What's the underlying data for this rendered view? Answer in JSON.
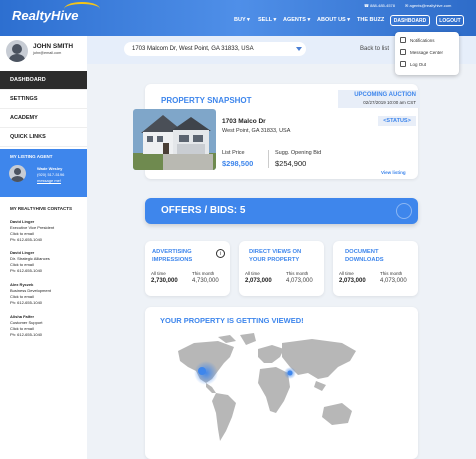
{
  "brand": {
    "logo_text": "RealtyHive"
  },
  "header": {
    "phone": "888-485-4578",
    "email": "agents@realtyhive.com",
    "nav": [
      {
        "label": "BUY"
      },
      {
        "label": "SELL"
      },
      {
        "label": "AGENTS"
      },
      {
        "label": "ABOUT US"
      },
      {
        "label": "THE BUZZ"
      }
    ],
    "dashboard_button": "DASHBOARD",
    "logout_button": "LOGOUT"
  },
  "user": {
    "name": "JOHN SMITH",
    "email": "john@email.com"
  },
  "sidebar": {
    "items": [
      {
        "label": "DASHBOARD",
        "active": true
      },
      {
        "label": "SETTINGS"
      },
      {
        "label": "ACADEMY"
      },
      {
        "label": "QUICK LINKS"
      }
    ],
    "agent": {
      "title": "MY LISTING AGENT",
      "name": "Wade Wesley",
      "phone": "(920) 517-5196",
      "message": "message me!"
    },
    "contacts_title": "MY REALTYHIVE CONTACTS",
    "contacts": [
      {
        "name": "David Linger",
        "role": "Executive Vice President",
        "email": "Click to email",
        "phone": "Ph: 612-655-1040"
      },
      {
        "name": "David Linger",
        "role": "Dir. Strategic Alliances",
        "email": "Click to email",
        "phone": "Ph: 612-655-1040"
      },
      {
        "name": "Alex Ryczek",
        "role": "Business Development",
        "email": "Click to email",
        "phone": "Ph: 612-655-1040"
      },
      {
        "name": "Alisha Falfer",
        "role": "Customer Support",
        "email": "Click to email",
        "phone": "Ph: 612-655-1040"
      }
    ]
  },
  "search": {
    "address": "1703 Malcom Dr, West Point, GA 31833, USA",
    "back_link": "Back to list"
  },
  "dropdown": {
    "items": [
      {
        "label": "Notifications"
      },
      {
        "label": "Message Center"
      },
      {
        "label": "Log Out"
      }
    ]
  },
  "snapshot": {
    "title": "PROPERTY SNAPSHOT",
    "auction_title": "UPCOMING AUCTION",
    "auction_date": "02/27/2019 10:00 am CST",
    "status": "<STATUS>",
    "address_line1": "1703 Malco Dr",
    "address_line2": "West Point, GA 31833, USA",
    "list_price_label": "List Price",
    "list_price": "$298,500",
    "opening_bid_label": "Sugg. Opening Bid",
    "opening_bid": "$254,900",
    "view_listing": "View listing"
  },
  "offers": {
    "label": "OFFERS / BIDS: 5"
  },
  "stats": [
    {
      "title_l1": "ADVERTISING",
      "title_l2": "IMPRESSIONS",
      "all_label": "All time",
      "all": "2,730,000",
      "month_label": "This month",
      "month": "4,730,000"
    },
    {
      "title_l1": "DIRECT VIEWS ON",
      "title_l2": "YOUR PROPERTY",
      "all_label": "All time",
      "all": "2,073,000",
      "month_label": "This month",
      "month": "4,073,000"
    },
    {
      "title_l1": "DOCUMENT",
      "title_l2": "DOWNLOADS",
      "all_label": "All time",
      "all": "2,073,000",
      "month_label": "This month",
      "month": "4,073,000"
    }
  ],
  "map": {
    "title": "YOUR PROPERTY IS GETTING VIEWED!"
  },
  "colors": {
    "accent": "#3e86ec",
    "sidebar_active": "#2c2c2c",
    "header": "#2d6fd0"
  }
}
